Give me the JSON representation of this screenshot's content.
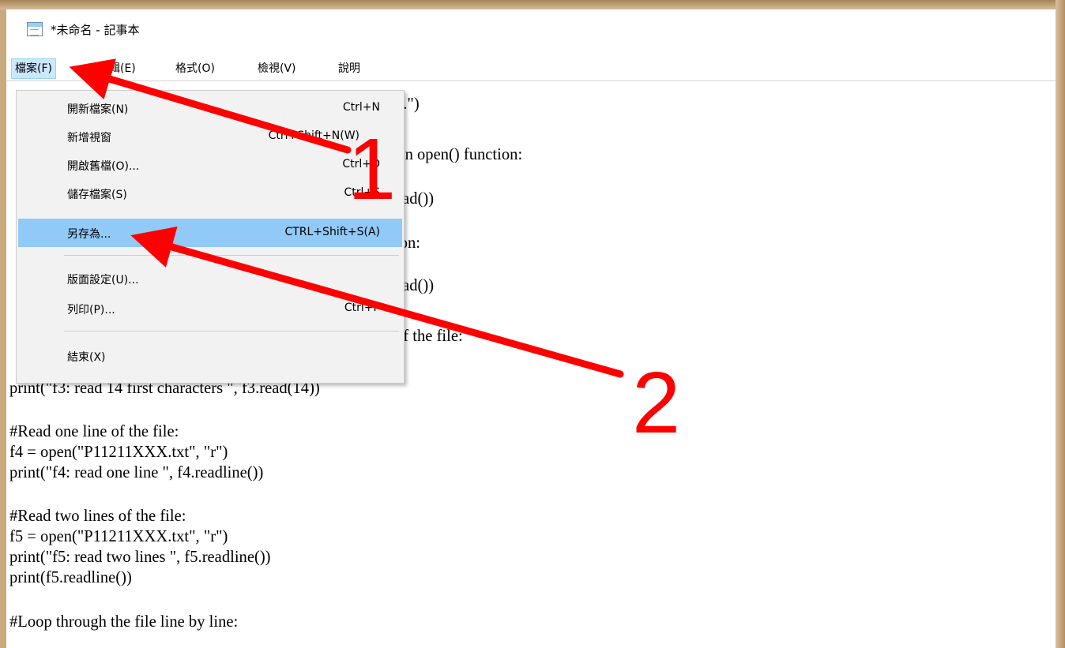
{
  "window": {
    "title": "*未命名 - 記事本"
  },
  "menubar": {
    "items": [
      {
        "label": "檔案(F)"
      },
      {
        "label": "編輯(E)"
      },
      {
        "label": "格式(O)"
      },
      {
        "label": "檢視(V)"
      },
      {
        "label": "說明"
      }
    ]
  },
  "file_menu": {
    "items": [
      {
        "label": "開新檔案(N)",
        "shortcut": "Ctrl+N"
      },
      {
        "label": "新增視窗",
        "shortcut": "Ctrl+Shift+N(W)"
      },
      {
        "label": "開啟舊檔(O)...",
        "shortcut": "Ctrl+O"
      },
      {
        "label": "儲存檔案(S)",
        "shortcut": "Ctrl+S"
      },
      {
        "label": "另存為...",
        "shortcut": "CTRL+Shift+S(A)"
      },
      {
        "label": "版面設定(U)...",
        "shortcut": ""
      },
      {
        "label": "列印(P)...",
        "shortcut": "Ctrl+P"
      },
      {
        "label": "結束(X)",
        "shortcut": ""
      }
    ]
  },
  "editor": {
    "lines": [
      "3.\")",
      "-in open() function:",
      "ead())",
      "ion:",
      ")",
      "ead())",
      "of the file:",
      "print(\"f3: read 14 first characters \", f3.read(14))",
      "#Read one line of the file:",
      "f4 = open(\"P11211XXX.txt\", \"r\")",
      "print(\"f4: read one line \", f4.readline())",
      "#Read two lines of the file:",
      "f5 = open(\"P11211XXX.txt\", \"r\")",
      "print(\"f5: read two lines \", f5.readline())",
      "print(f5.readline())",
      "#Loop through the file line by line:"
    ]
  },
  "annotations": {
    "step1": "1",
    "step2": "2",
    "arrow_color": "#ff0000"
  }
}
